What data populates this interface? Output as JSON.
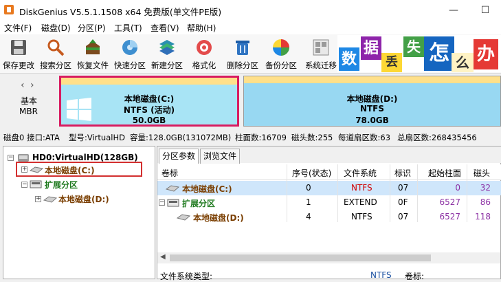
{
  "window": {
    "title": "DiskGenius V5.5.1.1508 x64 免费版(单文件PE版)",
    "minimize": "—",
    "maximize": "☐"
  },
  "menu": [
    "文件(F)",
    "磁盘(D)",
    "分区(P)",
    "工具(T)",
    "查看(V)",
    "帮助(H)"
  ],
  "toolbar": [
    {
      "label": "保存更改",
      "icon": "save-icon",
      "color": "#6b6b6b"
    },
    {
      "label": "搜索分区",
      "icon": "search-icon",
      "color": "#c66a2a"
    },
    {
      "label": "恢复文件",
      "icon": "recover-icon",
      "color": "#3a8d3a"
    },
    {
      "label": "快速分区",
      "icon": "quick-partition-icon",
      "color": "#2f86c9"
    },
    {
      "label": "新建分区",
      "icon": "new-partition-icon",
      "color": "#1f8fa8"
    },
    {
      "label": "格式化",
      "icon": "format-icon",
      "color": "#d23b3b"
    },
    {
      "label": "删除分区",
      "icon": "delete-icon",
      "color": "#2f74c2"
    },
    {
      "label": "备份分区",
      "icon": "backup-icon",
      "color": "#e0a020"
    },
    {
      "label": "系统迁移",
      "icon": "migrate-icon",
      "color": "#8a8a8a"
    }
  ],
  "ad": {
    "chars": [
      "数",
      "据",
      "丢",
      "失",
      "怎",
      "么",
      "办"
    ]
  },
  "diskmap": {
    "type_label": "基本",
    "scheme_label": "MBR",
    "partitions": [
      {
        "name": "本地磁盘(C:)",
        "fs": "NTFS (活动)",
        "size": "50.0GB"
      },
      {
        "name": "本地磁盘(D:)",
        "fs": "NTFS",
        "size": "78.0GB"
      }
    ]
  },
  "infobar": [
    "磁盘0 接口:ATA",
    "型号:VirtualHD",
    "容量:128.0GB(131072MB)",
    "柱面数:16709",
    "磁头数:255",
    "每道扇区数:63",
    "总扇区数:268435456"
  ],
  "tree": {
    "disk": "HD0:VirtualHD(128GB)",
    "c": "本地磁盘(C:)",
    "ext": "扩展分区",
    "d": "本地磁盘(D:)"
  },
  "tabs": [
    "分区参数",
    "浏览文件"
  ],
  "table": {
    "headers": [
      "卷标",
      "序号(状态)",
      "文件系统",
      "标识",
      "起始柱面",
      "磁头"
    ],
    "rows": [
      {
        "label": "本地磁盘(C:)",
        "index": "0",
        "fs": "NTFS",
        "id": "07",
        "start": "0",
        "head": "32"
      },
      {
        "label": "扩展分区",
        "index": "1",
        "fs": "EXTEND",
        "id": "0F",
        "start": "6527",
        "head": "86"
      },
      {
        "label": "本地磁盘(D:)",
        "index": "4",
        "fs": "NTFS",
        "id": "07",
        "start": "6527",
        "head": "118"
      }
    ]
  },
  "bottom": {
    "fs_type_label": "文件系统类型:",
    "fs_type_value": "NTFS",
    "volume_label": "卷标:"
  },
  "colors": {
    "highlight": "#d81b60",
    "c_label": "#7a3e00",
    "ext_label": "#1f7a1f",
    "num_purple": "#8b2fa3",
    "fs_red": "#d00000"
  }
}
